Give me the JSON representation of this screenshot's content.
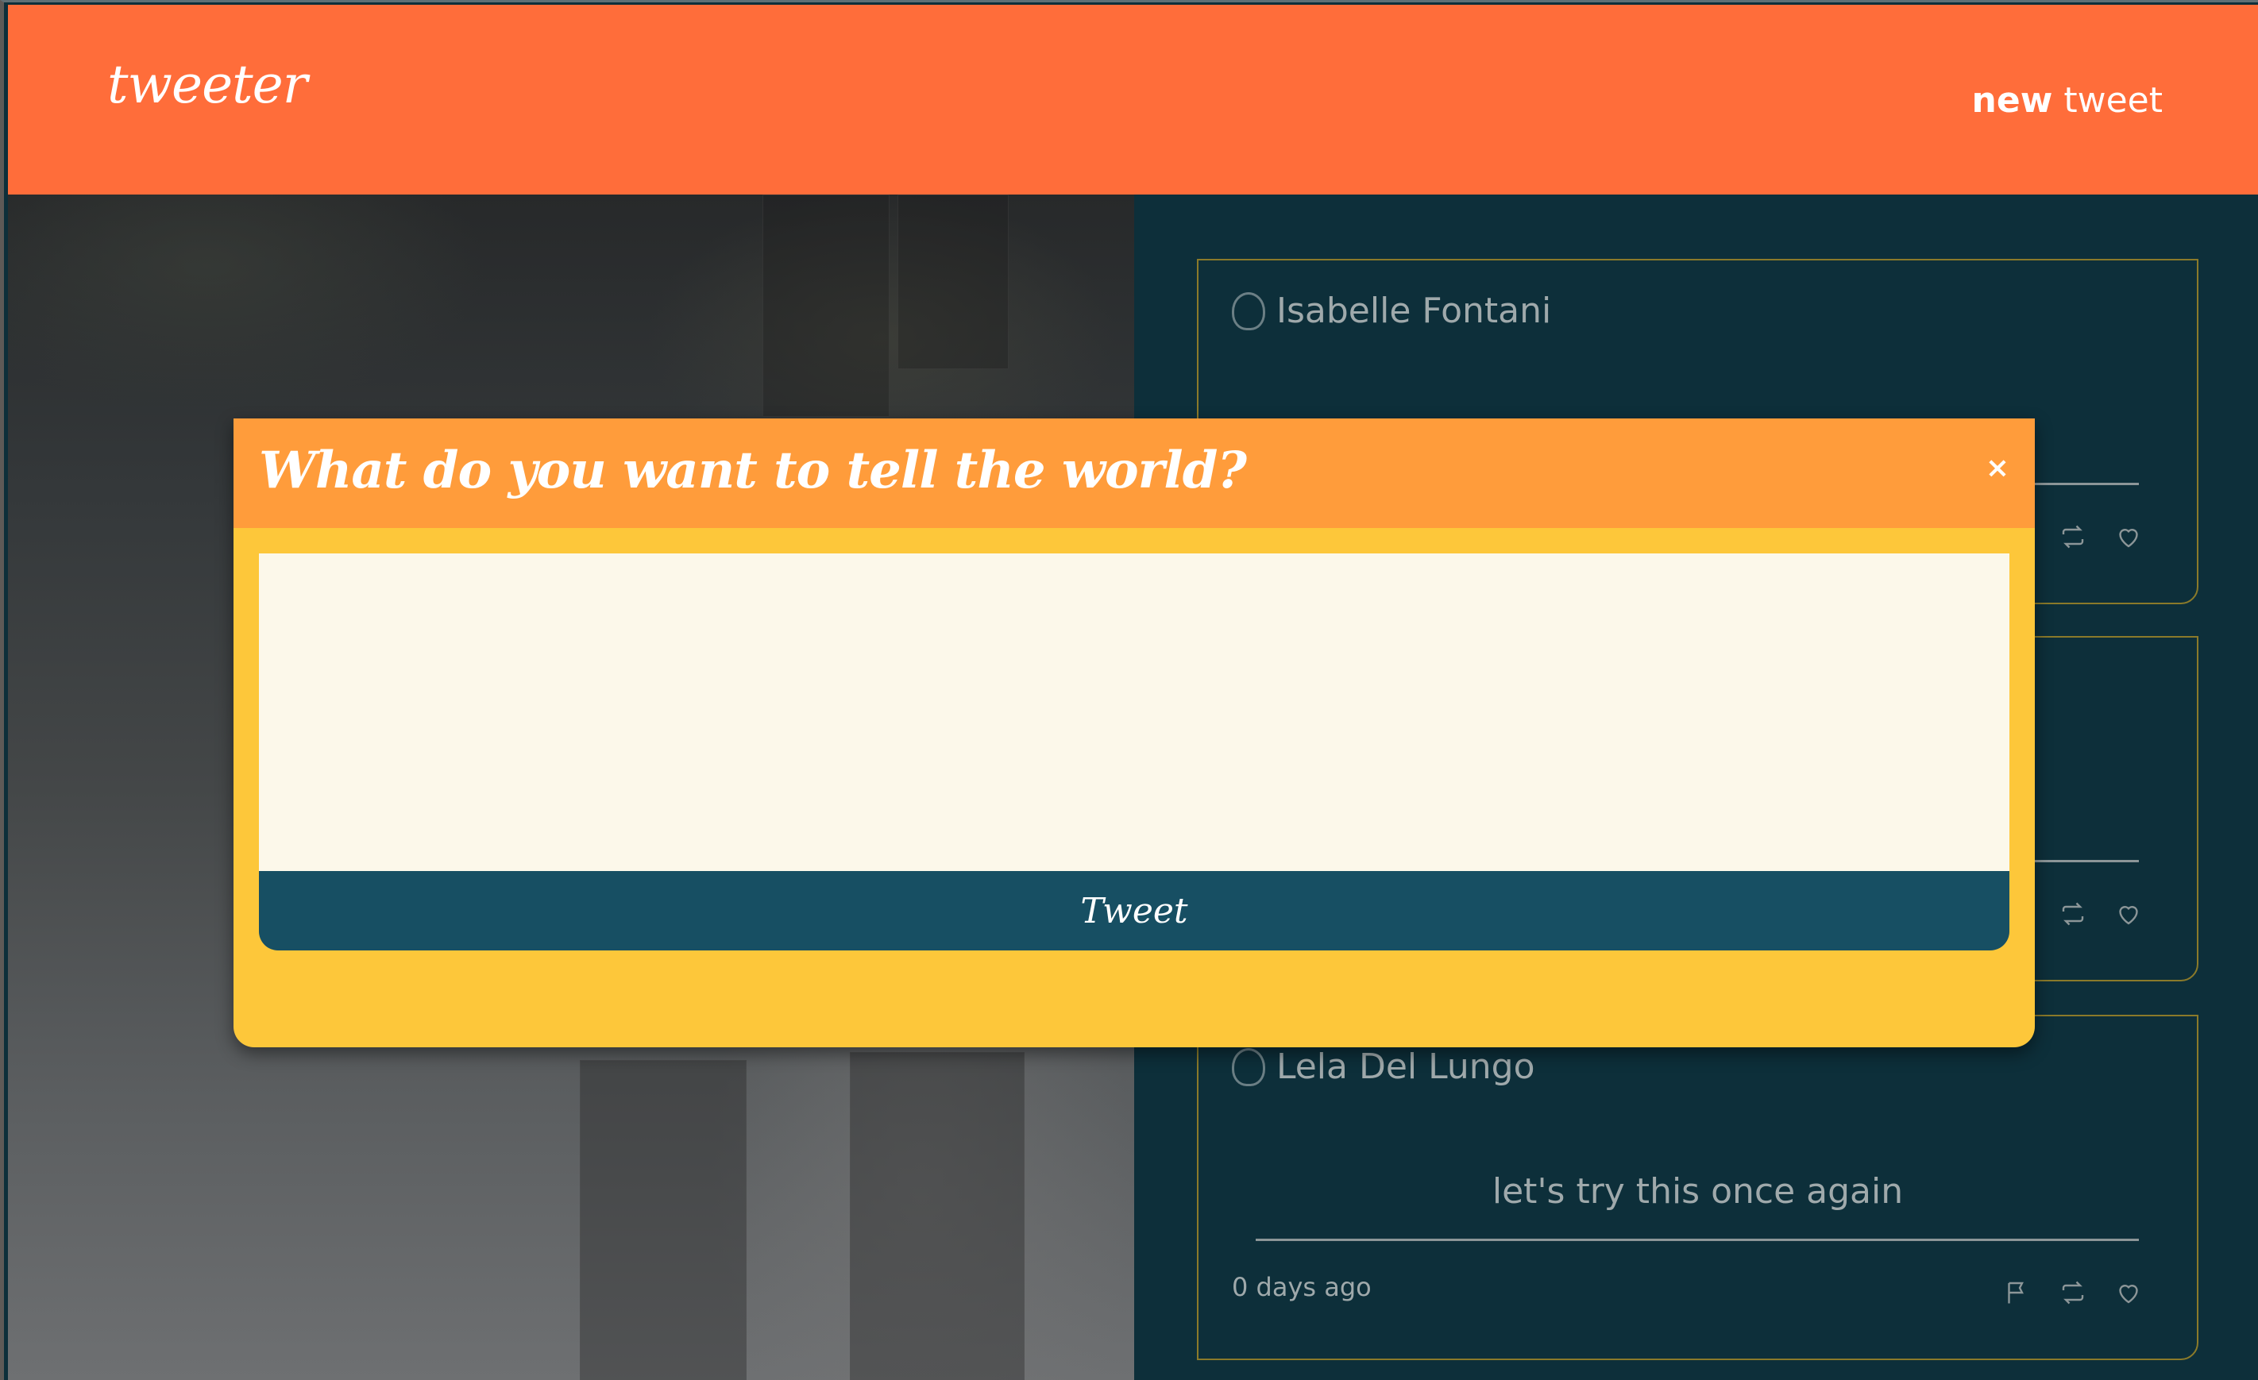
{
  "header": {
    "brand": "tweeter",
    "new_tweet_bold": "new",
    "new_tweet_rest": "tweet"
  },
  "feed": {
    "tweets": [
      {
        "author": "Isabelle Fontani",
        "text": "",
        "timestamp": ""
      },
      {
        "author": "",
        "text": "",
        "timestamp": ""
      },
      {
        "author": "Lela Del Lungo",
        "text": "let's try this once again",
        "timestamp": "0 days ago"
      }
    ]
  },
  "modal": {
    "title": "What do you want to tell the world?",
    "close_label": "×",
    "input_value": "",
    "input_placeholder": "",
    "submit_label": "Tweet"
  },
  "icons": {
    "avatar": "avatar-icon",
    "flag": "flag-icon",
    "retweet": "retweet-icon",
    "like": "heart-icon"
  },
  "colors": {
    "header_bg": "#ff6d3a",
    "feed_bg": "#0d2f3a",
    "modal_head": "#ff9c3b",
    "modal_body": "#fdc73a",
    "button": "#174f63"
  }
}
